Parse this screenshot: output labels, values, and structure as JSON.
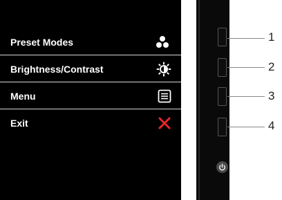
{
  "osd_menu": {
    "items": [
      {
        "label": "Preset Modes",
        "icon": "preset-modes-icon"
      },
      {
        "label": "Brightness/Contrast",
        "icon": "brightness-icon"
      },
      {
        "label": "Menu",
        "icon": "menu-icon"
      },
      {
        "label": "Exit",
        "icon": "exit-x-icon"
      }
    ]
  },
  "monitor_buttons": [
    "1",
    "2",
    "3",
    "4"
  ],
  "power_button": {
    "icon": "power-icon"
  },
  "colors": {
    "exit_icon": "#e8262b",
    "osd_background": "#000000"
  }
}
